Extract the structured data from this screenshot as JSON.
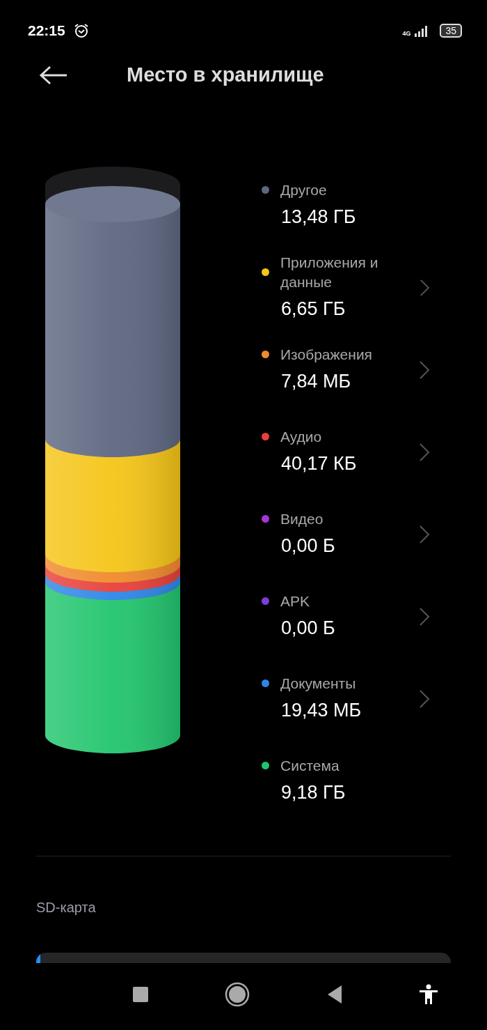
{
  "status_bar": {
    "time": "22:15",
    "network": "4G",
    "battery": "35"
  },
  "header": {
    "title": "Место в хранилище"
  },
  "categories": [
    {
      "label": "Другое",
      "size": "13,48 ГБ",
      "color": "#5e6781",
      "navigable": false
    },
    {
      "label": "Приложения и данные",
      "size": "6,65 ГБ",
      "color": "#f5c518",
      "navigable": true
    },
    {
      "label": "Изображения",
      "size": "7,84 МБ",
      "color": "#f08a2c",
      "navigable": true
    },
    {
      "label": "Аудио",
      "size": "40,17 КБ",
      "color": "#e8403a",
      "navigable": true
    },
    {
      "label": "Видео",
      "size": "0,00 Б",
      "color": "#a436d6",
      "navigable": true
    },
    {
      "label": "APK",
      "size": "0,00 Б",
      "color": "#7a3fd6",
      "navigable": true
    },
    {
      "label": "Документы",
      "size": "19,43 МБ",
      "color": "#2f86e6",
      "navigable": true
    },
    {
      "label": "Система",
      "size": "9,18 ГБ",
      "color": "#22c56e",
      "navigable": false
    }
  ],
  "sd_card": {
    "label": "SD-карта",
    "level": 0.01
  }
}
